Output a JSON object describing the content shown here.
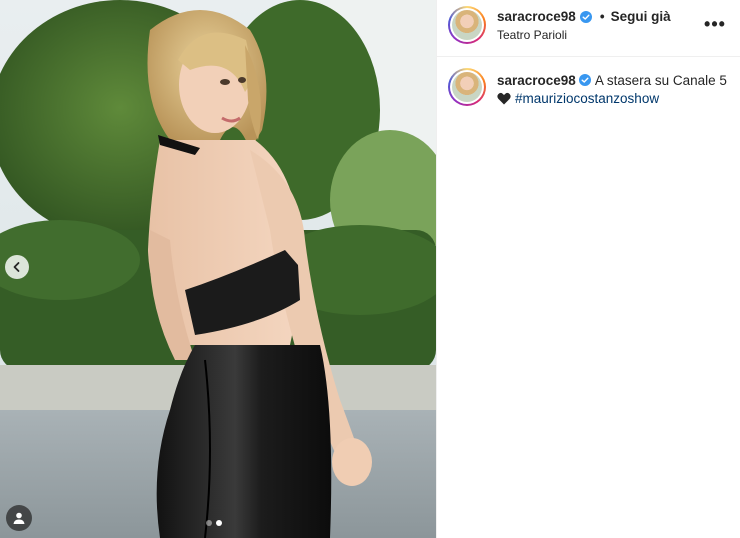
{
  "post": {
    "username": "saracroce98",
    "separator": "•",
    "follow_label": "Segui già",
    "location": "Teatro Parioli",
    "more_label": "•••",
    "verified": true
  },
  "caption": {
    "username": "saracroce98",
    "text": "A stasera su Canale 5",
    "hashtag": "#mauriziocostanzoshow"
  },
  "carousel": {
    "slides": 2,
    "active_slide": 2
  },
  "icons": {
    "verified": "verified-badge-icon",
    "prev": "chevron-left-icon",
    "tag": "user-tag-icon",
    "heart": "black-heart-icon"
  },
  "colors": {
    "verified_blue": "#3897f0",
    "hashtag_blue": "#00376b",
    "text": "#262626"
  }
}
